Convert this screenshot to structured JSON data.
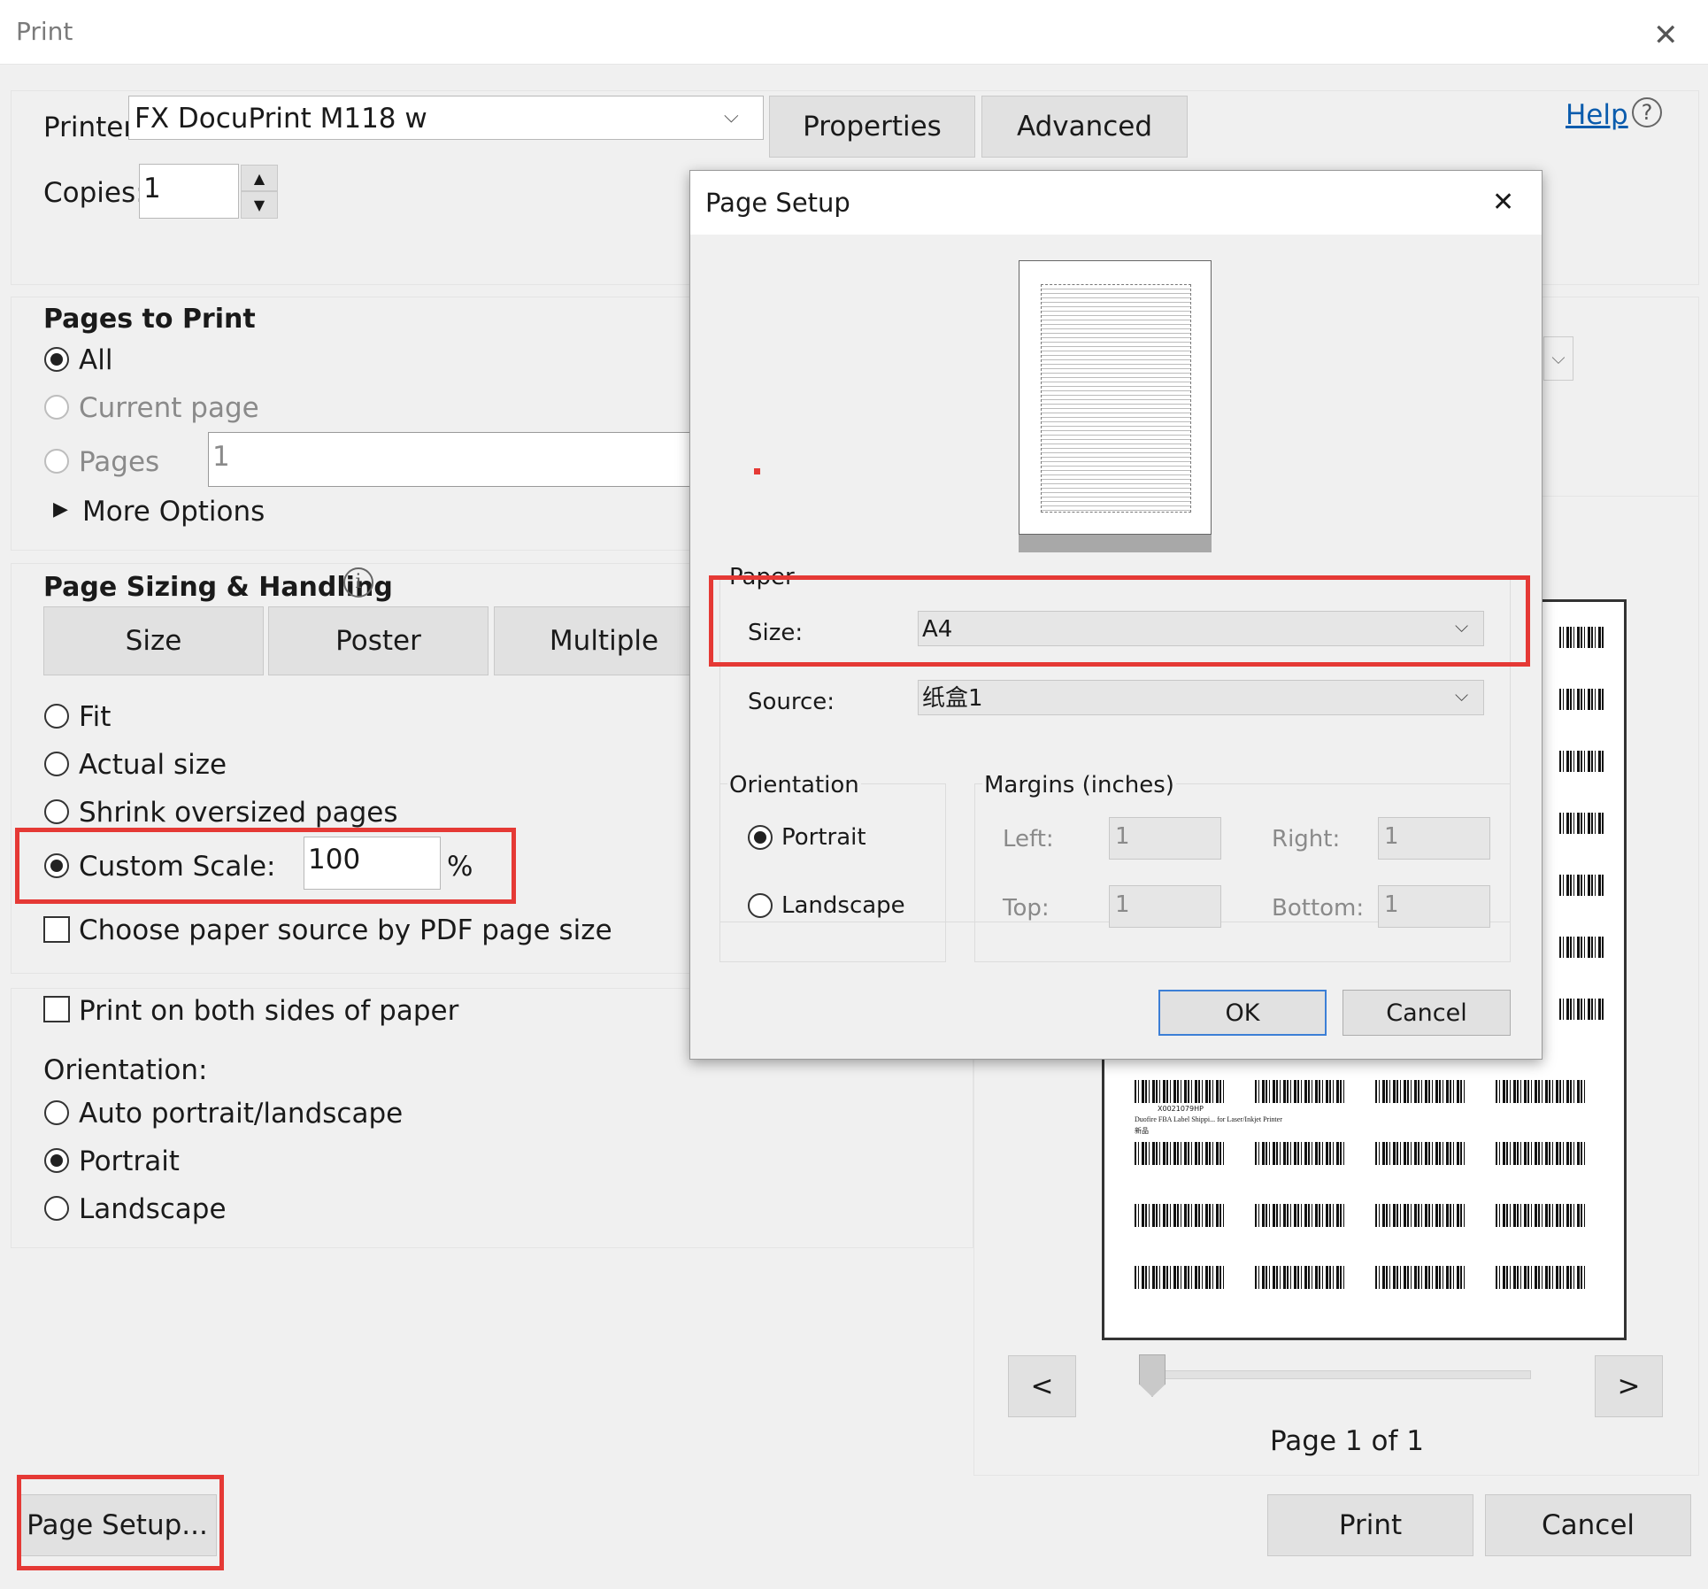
{
  "window": {
    "title": "Print",
    "close_glyph": "✕"
  },
  "printer": {
    "label": "Printer:",
    "value": "FX DocuPrint M118 w",
    "properties": "Properties",
    "advanced": "Advanced",
    "help": "Help"
  },
  "copies": {
    "label": "Copies:",
    "value": "1"
  },
  "pages_to_print": {
    "header": "Pages to Print",
    "all": "All",
    "current": "Current page",
    "pages": "Pages",
    "pages_value": "1",
    "more": "More Options"
  },
  "sizing": {
    "header": "Page Sizing & Handling",
    "tabs": [
      "Size",
      "Poster",
      "Multiple"
    ],
    "fit": "Fit",
    "actual": "Actual size",
    "shrink": "Shrink oversized pages",
    "custom": "Custom Scale:",
    "scale_value": "100",
    "percent": "%",
    "choose_source": "Choose paper source by PDF page size"
  },
  "duplex": {
    "label": "Print on both sides of paper"
  },
  "orientation": {
    "label": "Orientation:",
    "auto": "Auto portrait/landscape",
    "portrait": "Portrait",
    "landscape": "Landscape"
  },
  "preview": {
    "prev": "<",
    "next": ">",
    "page_label": "Page 1 of 1",
    "barcode_text": "X0021079HP",
    "caption": "Duofire FBA Label Shippi... for Laser/Inkjet Printer",
    "sub": "新品"
  },
  "footer": {
    "page_setup": "Page Setup...",
    "print": "Print",
    "cancel": "Cancel"
  },
  "page_setup_dialog": {
    "title": "Page Setup",
    "close_glyph": "✕",
    "paper_group": "Paper",
    "size_label": "Size:",
    "size_value": "A4",
    "source_label": "Source:",
    "source_value": "纸盒1",
    "orientation_group": "Orientation",
    "portrait": "Portrait",
    "landscape": "Landscape",
    "margins_group": "Margins (inches)",
    "left_label": "Left:",
    "left_value": "1",
    "right_label": "Right:",
    "right_value": "1",
    "top_label": "Top:",
    "top_value": "1",
    "bottom_label": "Bottom:",
    "bottom_value": "1",
    "ok": "OK",
    "cancel": "Cancel"
  },
  "colors": {
    "highlight_red": "#e53935",
    "link_blue": "#0b5cad",
    "ok_border": "#3c7fd6"
  }
}
